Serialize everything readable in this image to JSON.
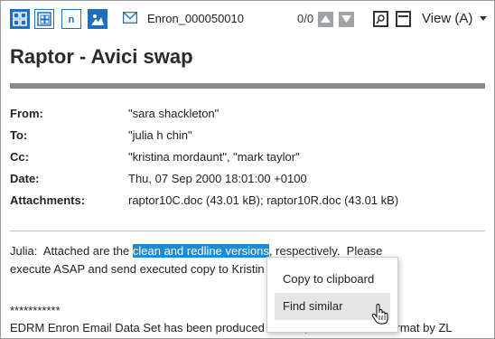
{
  "toolbar": {
    "doc_id": "Enron_000050010",
    "counter": "0/0",
    "view_label": "View (A)",
    "view_n_label": "n",
    "icons": [
      "grid-view-icon",
      "split-view-icon",
      "text-view-icon",
      "image-view-icon",
      "email-icon",
      "arrow-up-icon",
      "arrow-down-icon",
      "find-in-document-icon",
      "fit-width-icon",
      "dropdown-caret-icon"
    ]
  },
  "email": {
    "subject": "Raptor - Avici swap",
    "headers": [
      {
        "label": "From:",
        "value": "\"sara shackleton\""
      },
      {
        "label": "To:",
        "value": "\"julia h chin\""
      },
      {
        "label": "Cc:",
        "value": "\"kristina mordaunt\", \"mark taylor\""
      },
      {
        "label": "Date:",
        "value": "Thu, 07 Sep 2000 18:01:00 +0100"
      },
      {
        "label": "Attachments:",
        "value": "raptor10C.doc (43.01 kB); raptor10R.doc (43.01 kB)"
      }
    ],
    "body_line1_before": "Julia:  Attached are the ",
    "body_line1_highlight": "clean and redline versions",
    "body_line1_after": ", respectively.  Please",
    "body_line2": "execute ASAP and send executed copy to Kristin",
    "stars": "***********",
    "footer": "EDRM Enron Email Data Set has been produced in EML, PST and NSF format by ZL"
  },
  "context_menu": {
    "items": [
      "Copy to clipboard",
      "Find similar"
    ],
    "hovered": "Find similar"
  },
  "colors": {
    "accent": "#1e6fc0",
    "highlight": "#1e8ad6",
    "rule": "#8a8a8a"
  }
}
